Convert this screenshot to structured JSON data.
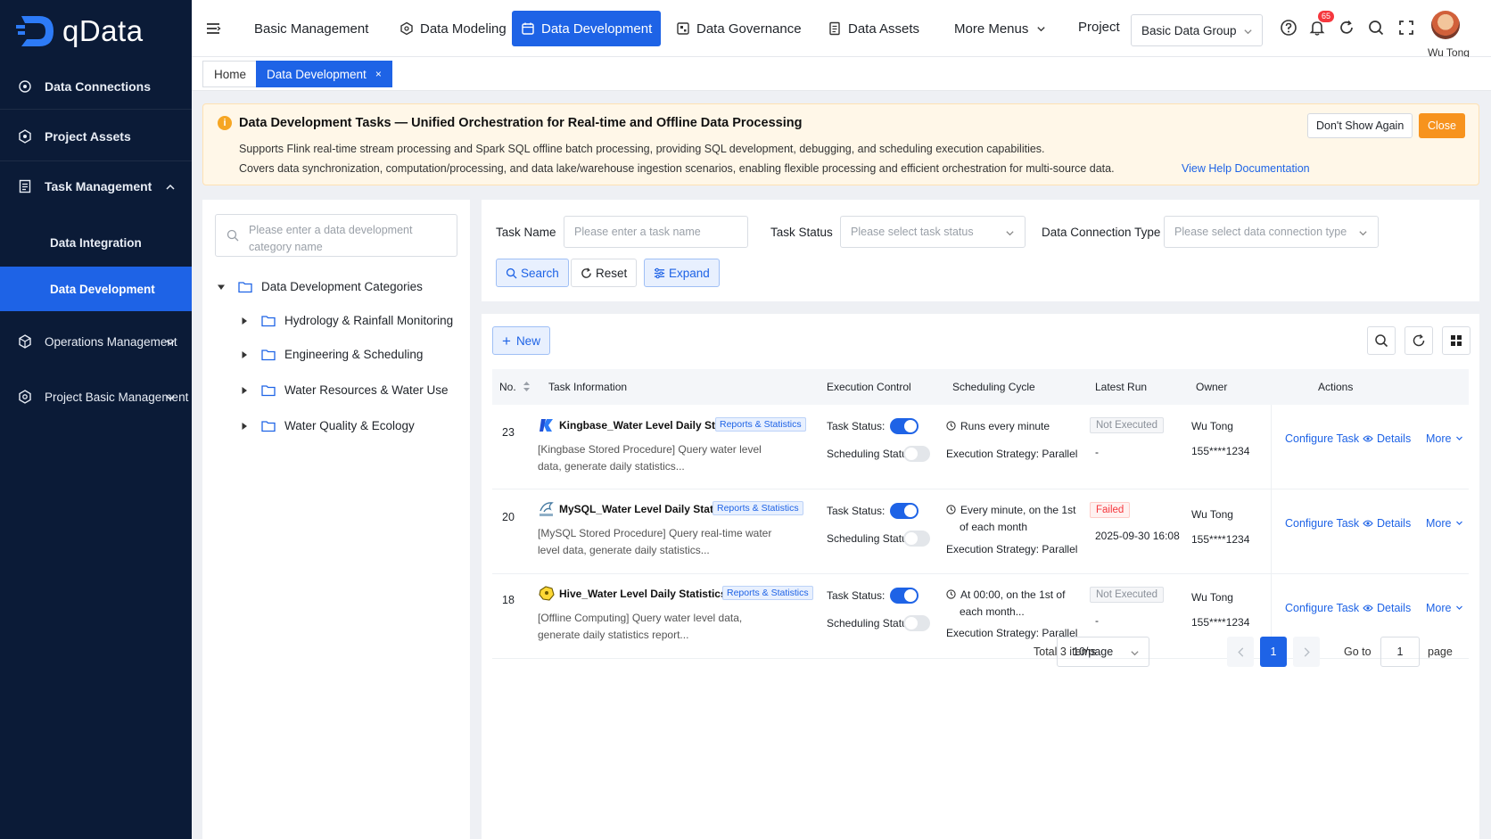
{
  "app": {
    "name": "qData"
  },
  "sidebar": {
    "items": [
      {
        "label": "Data Connections"
      },
      {
        "label": "Project Assets"
      },
      {
        "label": "Task Management"
      },
      {
        "label": "Operations Management"
      },
      {
        "label": "Project Basic Management"
      }
    ],
    "sub_items": [
      {
        "label": "Data Integration"
      },
      {
        "label": "Data Development"
      }
    ]
  },
  "topnav": {
    "items": [
      {
        "label": "Basic Management"
      },
      {
        "label": "Data Modeling"
      },
      {
        "label": "Data Development"
      },
      {
        "label": "Data Governance"
      },
      {
        "label": "Data Assets"
      },
      {
        "label": "More Menus"
      }
    ],
    "project_label": "Project",
    "project_value": "Basic Data Group",
    "notification_count": "65",
    "username": "Wu Tong"
  },
  "tabs": {
    "home": "Home",
    "current": "Data Development",
    "close": "×"
  },
  "notice": {
    "title": "Data Development Tasks — Unified Orchestration for Real-time and Offline Data Processing",
    "line1": "Supports Flink real-time stream processing and Spark SQL offline batch processing, providing SQL development, debugging, and scheduling execution capabilities.",
    "line2": "Covers data synchronization, computation/processing, and data lake/warehouse ingestion scenarios, enabling flexible processing and efficient orchestration for multi-source data.",
    "help_link": "View Help Documentation",
    "dont_show": "Don't Show Again",
    "close": "Close"
  },
  "categories": {
    "search_placeholder": "Please enter a data development category name",
    "root": "Data Development Categories",
    "nodes": [
      {
        "label": "Hydrology & Rainfall Monitoring"
      },
      {
        "label": "Engineering & Scheduling"
      },
      {
        "label": "Water Resources & Water Use"
      },
      {
        "label": "Water Quality & Ecology"
      }
    ]
  },
  "filters": {
    "task_name_label": "Task Name",
    "task_name_placeholder": "Please enter a task name",
    "task_status_label": "Task Status",
    "task_status_placeholder": "Please select task status",
    "conn_type_label": "Data Connection Type",
    "conn_type_placeholder": "Please select data connection type",
    "search": "Search",
    "reset": "Reset",
    "expand": "Expand"
  },
  "table": {
    "new_label": "New",
    "columns": {
      "no": "No.",
      "info": "Task Information",
      "exec": "Execution Control",
      "sched": "Scheduling Cycle",
      "latest": "Latest Run",
      "owner": "Owner",
      "actions": "Actions"
    },
    "labels": {
      "task_status": "Task Status:",
      "sched_status": "Scheduling Status:",
      "configure": "Configure Task",
      "details": "Details",
      "more": "More"
    },
    "rows": [
      {
        "no": "23",
        "name": "Kingbase_Water Level Daily Statistics",
        "tag": "Reports & Statistics",
        "desc": "[Kingbase Stored Procedure] Query water level data, generate daily statistics...",
        "cycle": "Runs every minute",
        "cycle2": "",
        "strategy": "Execution Strategy: Parallel",
        "status": "Not Executed",
        "latest_time": "-",
        "owner": "Wu Tong",
        "phone": "155****1234",
        "task_on": true,
        "sched_on": false
      },
      {
        "no": "20",
        "name": "MySQL_Water Level Daily Statistics",
        "tag": "Reports & Statistics",
        "desc": "[MySQL Stored Procedure] Query real-time water level data, generate daily statistics...",
        "cycle": "Every minute, on the 1st",
        "cycle2": "of each month",
        "strategy": "Execution Strategy: Parallel",
        "status": "Failed",
        "latest_time": "2025-09-30 16:08",
        "owner": "Wu Tong",
        "phone": "155****1234",
        "task_on": true,
        "sched_on": false
      },
      {
        "no": "18",
        "name": "Hive_Water Level Daily Statistics Report",
        "tag": "Reports & Statistics",
        "desc": "[Offline Computing] Query water level data, generate daily statistics report...",
        "cycle": "At 00:00, on the 1st of",
        "cycle2": "each month...",
        "strategy": "Execution Strategy: Parallel",
        "status": "Not Executed",
        "latest_time": "-",
        "owner": "Wu Tong",
        "phone": "155****1234",
        "task_on": true,
        "sched_on": false
      }
    ]
  },
  "pagination": {
    "total": "Total 3 items",
    "page_size": "10/page",
    "current": "1",
    "goto_label": "Go to",
    "goto_value": "1",
    "page_suffix": "page"
  },
  "colors": {
    "primary": "#1e63e6",
    "sidebar": "#0b1b37",
    "warning": "#f7931e",
    "danger": "#f5373d"
  }
}
